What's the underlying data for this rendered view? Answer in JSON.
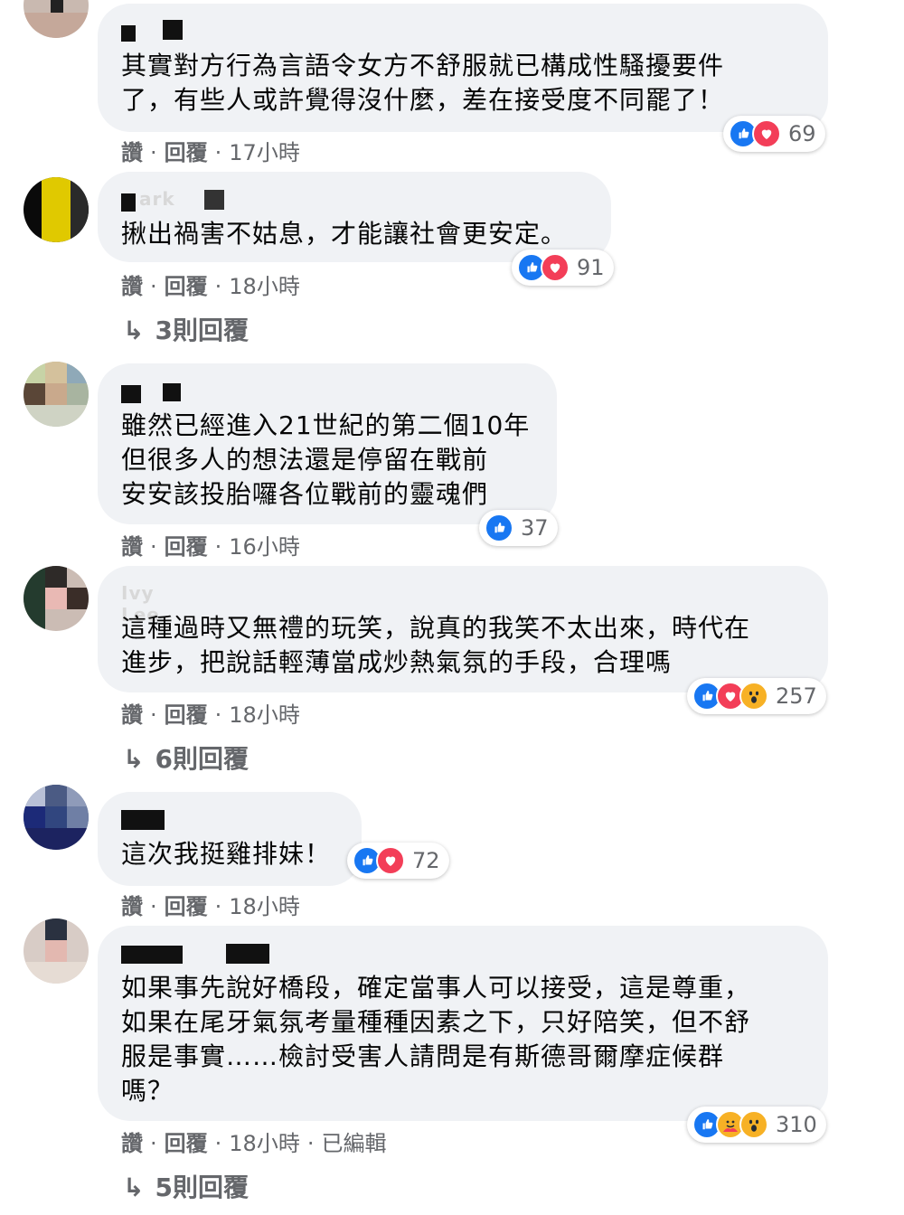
{
  "actions": {
    "like": "讚",
    "reply": "回覆",
    "separator": "·",
    "edited": "已編輯"
  },
  "comments": [
    {
      "text": "其實對方行為言語令女方不舒服就已構成性騷擾要件\n了，有些人或許覺得沒什麼，差在接受度不同罷了！",
      "time": "17小時",
      "reactions": [
        "like",
        "love"
      ],
      "reaction_count": "69",
      "replies": ""
    },
    {
      "text": "揪出禍害不姑息，才能讓社會更安定。",
      "time": "18小時",
      "reactions": [
        "like",
        "love"
      ],
      "reaction_count": "91",
      "replies": "3則回覆"
    },
    {
      "text": "雖然已經進入21世紀的第二個10年\n但很多人的想法還是停留在戰前\n安安該投胎囉各位戰前的靈魂們",
      "time": "16小時",
      "reactions": [
        "like"
      ],
      "reaction_count": "37",
      "replies": ""
    },
    {
      "text": "這種過時又無禮的玩笑，說真的我笑不太出來，時代在\n進步，把說話輕薄當成炒熱氣氛的手段，合理嗎",
      "time": "18小時",
      "reactions": [
        "like",
        "love",
        "wow"
      ],
      "reaction_count": "257",
      "replies": "6則回覆"
    },
    {
      "text": "這次我挺雞排妹！",
      "time": "18小時",
      "reactions": [
        "like",
        "love"
      ],
      "reaction_count": "72",
      "replies": ""
    },
    {
      "text": "如果事先說好橋段，確定當事人可以接受，這是尊重，\n如果在尾牙氣氛考量種種因素之下，只好陪笑，但不舒\n服是事實……檢討受害人請問是有斯德哥爾摩症候群\n嗎？",
      "time": "18小時",
      "edited": true,
      "reactions": [
        "like",
        "care",
        "wow"
      ],
      "reaction_count": "310",
      "replies": "5則回覆"
    }
  ],
  "colors": {
    "bubble": "#f0f2f5",
    "meta_text": "#65676b",
    "like": "#1877f2",
    "love": "#f33e58",
    "wow": "#f7b125"
  }
}
